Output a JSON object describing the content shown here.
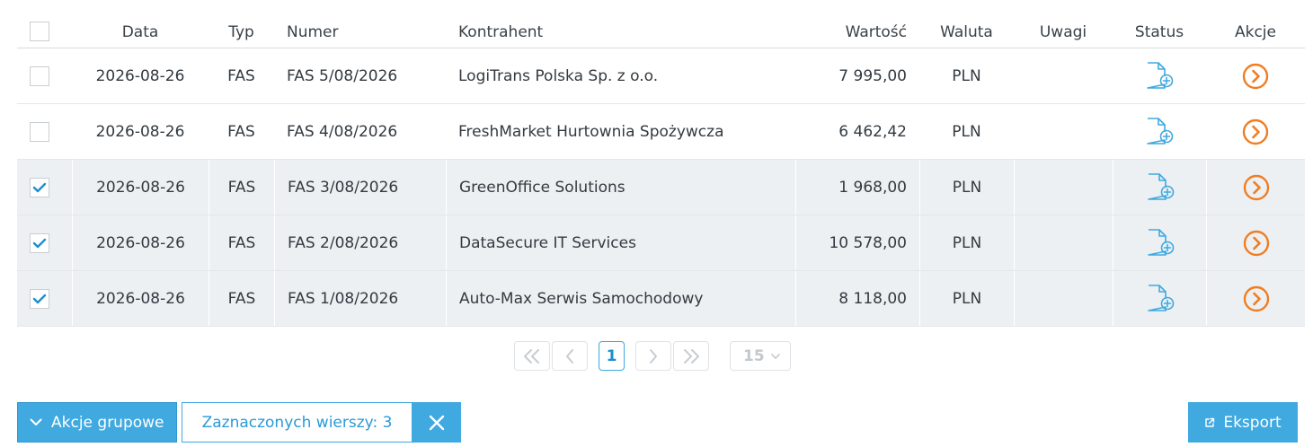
{
  "columns": {
    "data": "Data",
    "typ": "Typ",
    "numer": "Numer",
    "kontrahent": "Kontrahent",
    "wartosc": "Wartość",
    "waluta": "Waluta",
    "uwagi": "Uwagi",
    "status": "Status",
    "akcje": "Akcje"
  },
  "rows": [
    {
      "selected": false,
      "data": "2026-08-26",
      "typ": "FAS",
      "numer": "FAS 5/08/2026",
      "kontrahent": "LogiTrans Polska Sp. z o.o.",
      "wartosc": "7 995,00",
      "waluta": "PLN",
      "uwagi": ""
    },
    {
      "selected": false,
      "data": "2026-08-26",
      "typ": "FAS",
      "numer": "FAS 4/08/2026",
      "kontrahent": "FreshMarket Hurtownia Spożywcza",
      "wartosc": "6 462,42",
      "waluta": "PLN",
      "uwagi": ""
    },
    {
      "selected": true,
      "data": "2026-08-26",
      "typ": "FAS",
      "numer": "FAS 3/08/2026",
      "kontrahent": "GreenOffice Solutions",
      "wartosc": "1 968,00",
      "waluta": "PLN",
      "uwagi": ""
    },
    {
      "selected": true,
      "data": "2026-08-26",
      "typ": "FAS",
      "numer": "FAS 2/08/2026",
      "kontrahent": "DataSecure IT Services",
      "wartosc": "10 578,00",
      "waluta": "PLN",
      "uwagi": ""
    },
    {
      "selected": true,
      "data": "2026-08-26",
      "typ": "FAS",
      "numer": "FAS 1/08/2026",
      "kontrahent": "Auto-Max Serwis Samochodowy",
      "wartosc": "8 118,00",
      "waluta": "PLN",
      "uwagi": ""
    }
  ],
  "icons": {
    "status": "document-add-icon",
    "action": "arrow-circle-right-icon",
    "checkbox": "checkmark-icon"
  },
  "pagination": {
    "current_page": "1",
    "page_size": "15"
  },
  "footer": {
    "bulk_actions_label": "Akcje grupowe",
    "selected_rows_label": "Zaznaczonych wierszy: 3",
    "export_label": "Eksport"
  },
  "colors": {
    "accent": "#3fa9e0",
    "action_orange": "#f07d22",
    "selected_row_bg": "#edf0f3"
  }
}
